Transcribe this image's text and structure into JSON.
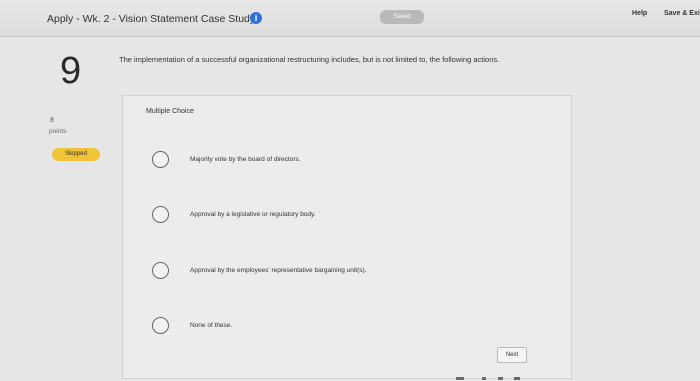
{
  "header": {
    "assignment_title": "Apply - Wk. 2 - Vision Statement Case Study",
    "info_icon": "info-icon",
    "saved_label": "Saved",
    "help_label": "Help",
    "save_exit_label": "Save & Exi"
  },
  "question": {
    "number": "9",
    "points_value": "8",
    "points_label": "points",
    "status_badge": "Skipped",
    "text": "The implementation of a successful organizational restructuring includes, but is not limited to, the following actions.",
    "type_label": "Multiple Choice",
    "options": [
      "Majority vote by the board of directors.",
      "Approval by a legislative or regulatory body.",
      "Approval by the employees' representative bargaining unit(s).",
      "None of these."
    ]
  },
  "footer": {
    "next_label": "Next"
  },
  "colors": {
    "info_accent": "#2f6fd6",
    "skipped_badge": "#f1c338",
    "saved_badge": "#b9b9b9"
  }
}
